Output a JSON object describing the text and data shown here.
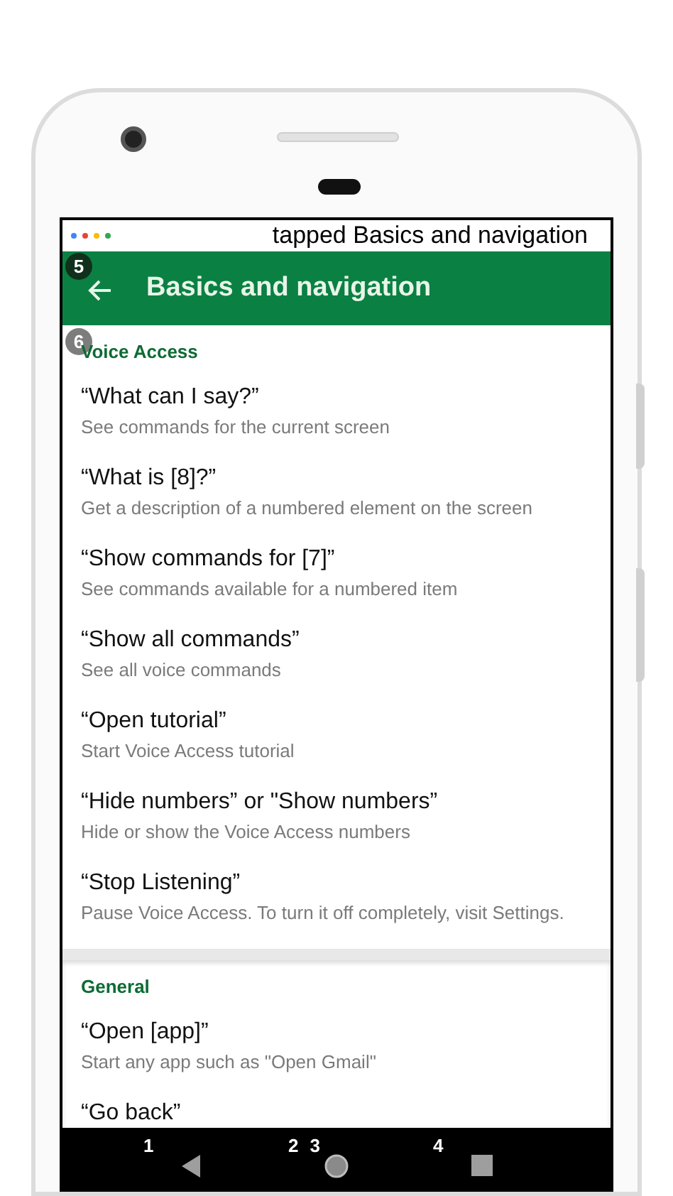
{
  "status": {
    "dots": [
      {
        "color": "#4285f4"
      },
      {
        "color": "#ea4335"
      },
      {
        "color": "#fbbc05"
      },
      {
        "color": "#34a853"
      }
    ],
    "announcement": "tapped Basics and navigation"
  },
  "app_bar": {
    "badge": "5",
    "title": "Basics and navigation"
  },
  "sections": [
    {
      "badge": "6",
      "title": "Voice Access",
      "items": [
        {
          "title": "“What can I say?”",
          "subtitle": "See commands for the current screen"
        },
        {
          "title": "“What is [8]?”",
          "subtitle": "Get a description of a numbered element on the screen"
        },
        {
          "title": "“Show commands for [7]”",
          "subtitle": "See commands available for a numbered item"
        },
        {
          "title": "“Show all commands”",
          "subtitle": "See all voice commands"
        },
        {
          "title": "“Open tutorial”",
          "subtitle": "Start Voice Access tutorial"
        },
        {
          "title": "“Hide numbers” or \"Show numbers”",
          "subtitle": "Hide or show the Voice Access numbers"
        },
        {
          "title": "“Stop Listening”",
          "subtitle": "Pause Voice Access. To turn it off completely, visit Settings."
        }
      ]
    },
    {
      "title": "General",
      "items": [
        {
          "title": "“Open [app]”",
          "subtitle": "Start any app such as \"Open Gmail\""
        },
        {
          "title": "“Go back”"
        }
      ]
    }
  ],
  "nav_bar": [
    {
      "kind": "back",
      "labels": [
        "1"
      ]
    },
    {
      "kind": "home",
      "labels": [
        "2",
        "3"
      ]
    },
    {
      "kind": "recents",
      "labels": [
        "4"
      ]
    }
  ]
}
